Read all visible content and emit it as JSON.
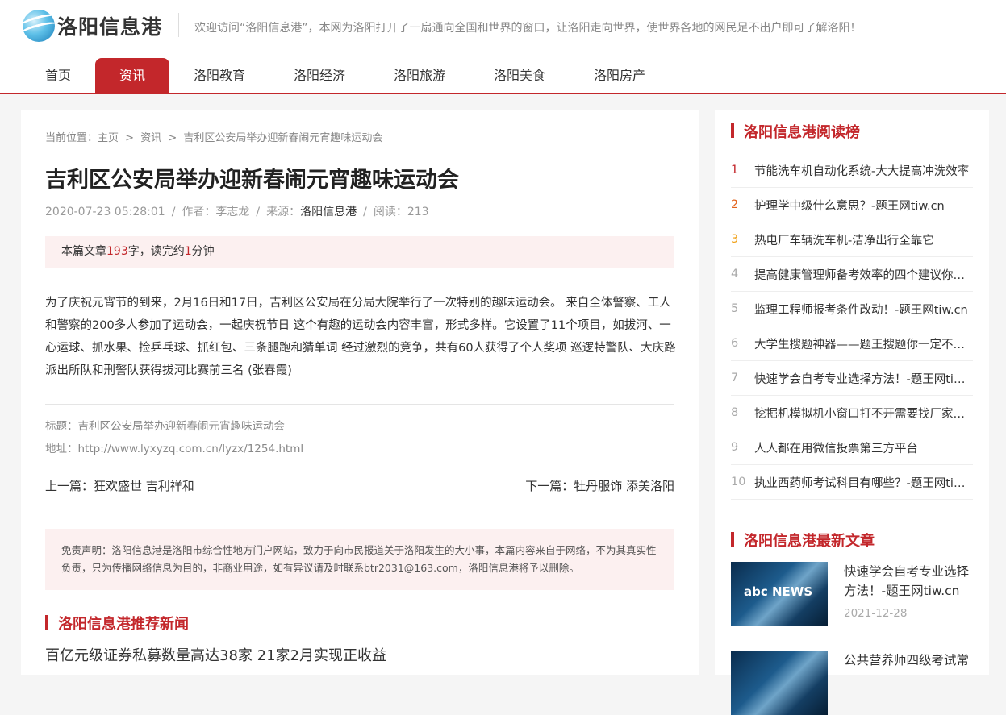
{
  "site": {
    "logo_text": "洛阳信息港",
    "slogan": "欢迎访问“洛阳信息港”，本网为洛阳打开了一扇通向全国和世界的窗口，让洛阳走向世界，使世界各地的网民足不出户即可了解洛阳！"
  },
  "nav": [
    {
      "label": "首页"
    },
    {
      "label": "资讯"
    },
    {
      "label": "洛阳教育"
    },
    {
      "label": "洛阳经济"
    },
    {
      "label": "洛阳旅游"
    },
    {
      "label": "洛阳美食"
    },
    {
      "label": "洛阳房产"
    }
  ],
  "breadcrumb": {
    "prefix": "当前位置：",
    "home": "主页",
    "sep": ">",
    "category": "资讯",
    "current": "吉利区公安局举办迎新春闹元宵趣味运动会"
  },
  "article": {
    "title": "吉利区公安局举办迎新春闹元宵趣味运动会",
    "date": "2020-07-23 05:28:01",
    "author": "作者：李志龙",
    "source_label": "来源：",
    "source": "洛阳信息港",
    "reads": "阅读：213",
    "notice_prefix": "本篇文章",
    "word_count": "193",
    "notice_mid": "字，读完约",
    "minutes": "1",
    "notice_suffix": "分钟",
    "body": "为了庆祝元宵节的到来，2月16日和17日，吉利区公安局在分局大院举行了一次特别的趣味运动会。 来自全体警察、工人和警察的200多人参加了运动会，一起庆祝节日 这个有趣的运动会内容丰富，形式多样。它设置了11个项目，如拔河、一心运球、抓水果、捡乒乓球、抓红包、三条腿跑和猜单词 经过激烈的竞争，共有60人获得了个人奖项 巡逻特警队、大庆路派出所队和刑警队获得拔河比赛前三名 (张春霞)",
    "info_title": "标题：吉利区公安局举办迎新春闹元宵趣味运动会",
    "info_url": "地址：http://www.lyxyzq.com.cn/lyzx/1254.html",
    "prev": "上一篇：狂欢盛世 吉利祥和",
    "next": "下一篇：牡丹服饰 添美洛阳",
    "disclaimer": "免责声明：洛阳信息港是洛阳市综合性地方门户网站，致力于向市民报道关于洛阳发生的大小事，本篇内容来自于网络，不为其真实性负责，只为传播网络信息为目的，非商业用途，如有异议请及时联系btr2031@163.com，洛阳信息港将予以删除。"
  },
  "recommend": {
    "heading": "洛阳信息港推荐新闻",
    "items": [
      "百亿元级证券私募数量高达38家 21家2月实现正收益"
    ]
  },
  "ranking": {
    "heading": "洛阳信息港阅读榜",
    "items": [
      {
        "num": "1",
        "title": "节能洗车机自动化系统-大大提高冲洗效率"
      },
      {
        "num": "2",
        "title": "护理学中级什么意思？-题王网tiw.cn"
      },
      {
        "num": "3",
        "title": "热电厂车辆洗车机-洁净出行全靠它"
      },
      {
        "num": "4",
        "title": "提高健康管理师备考效率的四个建议你知道吗"
      },
      {
        "num": "5",
        "title": "监理工程师报考条件改动！-题王网tiw.cn"
      },
      {
        "num": "6",
        "title": "大学生搜题神器——题王搜题你一定不能错过"
      },
      {
        "num": "7",
        "title": "快速学会自考专业选择方法！-题王网tiw.cn"
      },
      {
        "num": "8",
        "title": "挖掘机模拟机小窗口打不开需要找厂家解决吗"
      },
      {
        "num": "9",
        "title": "人人都在用微信投票第三方平台"
      },
      {
        "num": "10",
        "title": "执业西药师考试科目有哪些？-题王网tiw.cn"
      }
    ],
    "colors": {
      "first": "#c3272b",
      "second": "#e2621b",
      "third": "#f0a21b",
      "rest": "#aaaaaa"
    }
  },
  "latest": {
    "heading": "洛阳信息港最新文章",
    "items": [
      {
        "title": "快速学会自考专业选择方法！-题王网tiw.cn",
        "date": "2021-12-28",
        "thumb_text": "abc NEWS"
      },
      {
        "title": "公共营养师四级考试常",
        "date": "",
        "thumb_text": ""
      }
    ]
  },
  "colors": {
    "accent": "#c3272b",
    "notice_bg": "#fcf0f0",
    "page_bg": "#f5f5f5"
  }
}
